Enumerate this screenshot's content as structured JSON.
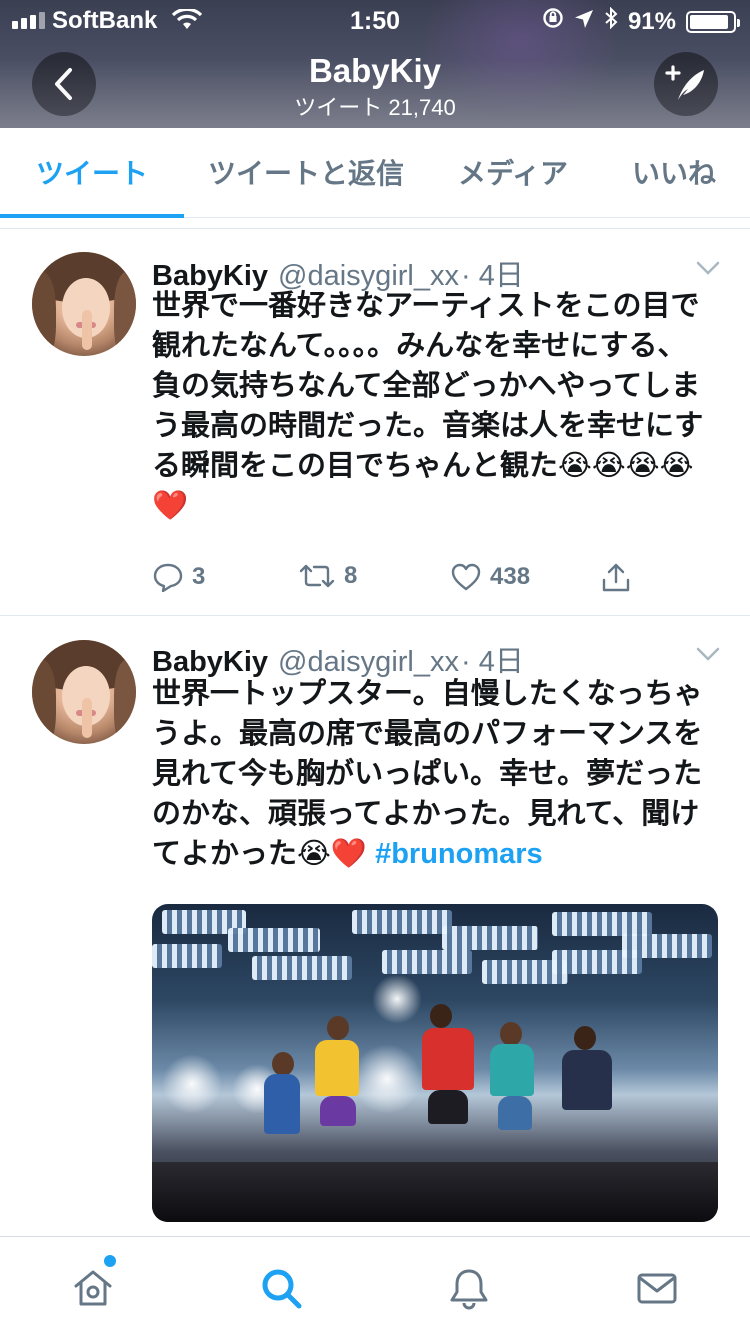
{
  "status_bar": {
    "carrier": "SoftBank",
    "time": "1:50",
    "battery_percent": "91%",
    "battery_level": 0.91
  },
  "header": {
    "title": "BabyKiy",
    "subtitle": "ツイート 21,740"
  },
  "tabs": [
    {
      "label": "ツイート",
      "active": true
    },
    {
      "label": "ツイートと返信",
      "active": false
    },
    {
      "label": "メディア",
      "active": false
    },
    {
      "label": "いいね",
      "active": false
    }
  ],
  "tweets": [
    {
      "name": "BabyKiy",
      "handle": "@daisygirl_xx",
      "time": "· 4日",
      "text": "世界で一番好きなアーティストをこの目で観れたなんて。。。。みんなを幸せにする、負の気持ちなんて全部どっかへやってしまう最高の時間だった。音楽は人を幸せにする瞬間をこの目でちゃんと観た😭😭😭😭❤️",
      "replies": "3",
      "retweets": "8",
      "likes": "438"
    },
    {
      "name": "BabyKiy",
      "handle": "@daisygirl_xx",
      "time": "· 4日",
      "text": "世界一トップスター。自慢したくなっちゃうよ。最高の席で最高のパフォーマンスを見れて今も胸がいっぱい。幸せ。夢だったのかな、頑張ってよかった。見れて、聞けてよかった😭❤️ ",
      "hashtag": "#brunomars"
    }
  ],
  "colors": {
    "accent": "#1da1f2",
    "secondary_text": "#657786",
    "divider": "#e1e8ed"
  },
  "bottom_nav": [
    {
      "icon": "home-icon",
      "has_notification": true
    },
    {
      "icon": "search-icon",
      "active": true
    },
    {
      "icon": "bell-icon"
    },
    {
      "icon": "mail-icon"
    }
  ]
}
